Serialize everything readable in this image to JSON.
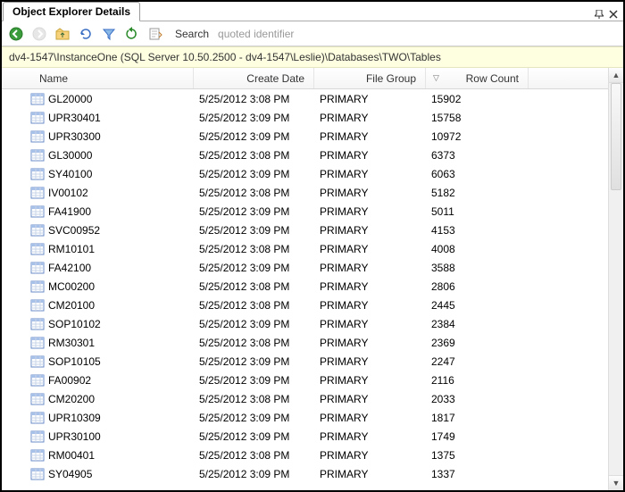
{
  "window": {
    "title": "Object Explorer Details"
  },
  "toolbar": {
    "search_label": "Search",
    "search_placeholder": "quoted identifier"
  },
  "path": "dv4-1547\\InstanceOne (SQL Server 10.50.2500 - dv4-1547\\Leslie)\\Databases\\TWO\\Tables",
  "columns": {
    "name": "Name",
    "create": "Create Date",
    "fg": "File Group",
    "rc": "Row Count"
  },
  "rows": [
    {
      "name": "GL20000",
      "create": "5/25/2012 3:08 PM",
      "fg": "PRIMARY",
      "rc": "15902"
    },
    {
      "name": "UPR30401",
      "create": "5/25/2012 3:09 PM",
      "fg": "PRIMARY",
      "rc": "15758"
    },
    {
      "name": "UPR30300",
      "create": "5/25/2012 3:09 PM",
      "fg": "PRIMARY",
      "rc": "10972"
    },
    {
      "name": "GL30000",
      "create": "5/25/2012 3:08 PM",
      "fg": "PRIMARY",
      "rc": "6373"
    },
    {
      "name": "SY40100",
      "create": "5/25/2012 3:09 PM",
      "fg": "PRIMARY",
      "rc": "6063"
    },
    {
      "name": "IV00102",
      "create": "5/25/2012 3:08 PM",
      "fg": "PRIMARY",
      "rc": "5182"
    },
    {
      "name": "FA41900",
      "create": "5/25/2012 3:09 PM",
      "fg": "PRIMARY",
      "rc": "5011"
    },
    {
      "name": "SVC00952",
      "create": "5/25/2012 3:09 PM",
      "fg": "PRIMARY",
      "rc": "4153"
    },
    {
      "name": "RM10101",
      "create": "5/25/2012 3:08 PM",
      "fg": "PRIMARY",
      "rc": "4008"
    },
    {
      "name": "FA42100",
      "create": "5/25/2012 3:09 PM",
      "fg": "PRIMARY",
      "rc": "3588"
    },
    {
      "name": "MC00200",
      "create": "5/25/2012 3:08 PM",
      "fg": "PRIMARY",
      "rc": "2806"
    },
    {
      "name": "CM20100",
      "create": "5/25/2012 3:08 PM",
      "fg": "PRIMARY",
      "rc": "2445"
    },
    {
      "name": "SOP10102",
      "create": "5/25/2012 3:09 PM",
      "fg": "PRIMARY",
      "rc": "2384"
    },
    {
      "name": "RM30301",
      "create": "5/25/2012 3:08 PM",
      "fg": "PRIMARY",
      "rc": "2369"
    },
    {
      "name": "SOP10105",
      "create": "5/25/2012 3:09 PM",
      "fg": "PRIMARY",
      "rc": "2247"
    },
    {
      "name": "FA00902",
      "create": "5/25/2012 3:09 PM",
      "fg": "PRIMARY",
      "rc": "2116"
    },
    {
      "name": "CM20200",
      "create": "5/25/2012 3:08 PM",
      "fg": "PRIMARY",
      "rc": "2033"
    },
    {
      "name": "UPR10309",
      "create": "5/25/2012 3:09 PM",
      "fg": "PRIMARY",
      "rc": "1817"
    },
    {
      "name": "UPR30100",
      "create": "5/25/2012 3:09 PM",
      "fg": "PRIMARY",
      "rc": "1749"
    },
    {
      "name": "RM00401",
      "create": "5/25/2012 3:08 PM",
      "fg": "PRIMARY",
      "rc": "1375"
    },
    {
      "name": "SY04905",
      "create": "5/25/2012 3:09 PM",
      "fg": "PRIMARY",
      "rc": "1337"
    }
  ]
}
